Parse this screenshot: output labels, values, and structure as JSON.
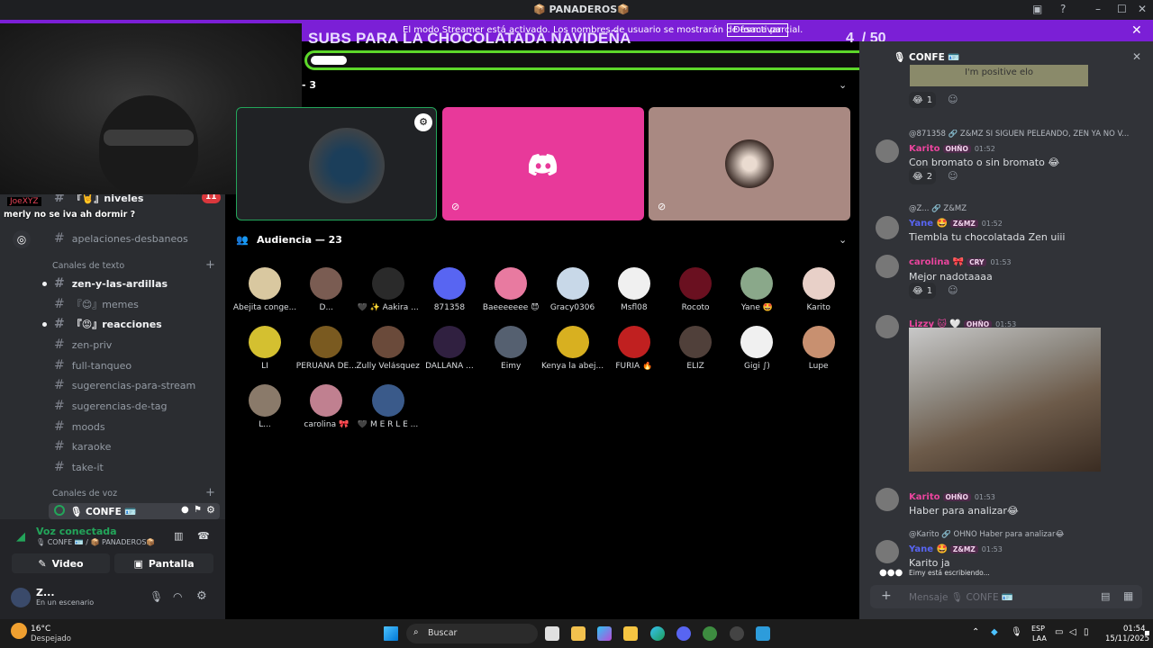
{
  "window": {
    "title": "📦 PANADEROS📦"
  },
  "streamer_banner": {
    "message": "El modo Streamer está activado. Los nombres de usuario se mostrarán de forma parcial.",
    "button": "Desactivar"
  },
  "goal": {
    "title": "SUBS PARA LA CHOCOLATADA NAVIDEÑA",
    "current": "4",
    "total": "/ 50",
    "progress": 0.08
  },
  "webcam": {
    "label_user": "JoeXYZ",
    "caption": "merly no se iva ah dormir ?"
  },
  "sidebar": {
    "channels_top": [
      {
        "label": "『🤘』niveles",
        "badge": "11"
      },
      {
        "label": "apelaciones-desbaneos"
      }
    ],
    "text_category": "Canales de texto",
    "text_channels": [
      {
        "label": "zen-y-las-ardillas",
        "bold": true
      },
      {
        "label": "『😊』memes"
      },
      {
        "label": "『😡』reacciones",
        "bold": true
      },
      {
        "label": "zen-priv"
      },
      {
        "label": "full-tanqueo"
      },
      {
        "label": "sugerencias-para-stream"
      },
      {
        "label": "sugerencias-de-tag"
      },
      {
        "label": "moods"
      },
      {
        "label": "karaoke"
      },
      {
        "label": "take-it"
      }
    ],
    "voice_category": "Canales de voz",
    "voice_channel": "🎙 CONFE 🪪",
    "voice_status": "Voz conectada",
    "voice_location": "🎙 CONFE 🪪 / 📦 PANADEROS📦",
    "video_button": "Video",
    "screen_button": "Pantalla",
    "user_name": "Z...",
    "user_status": "En un escenario"
  },
  "stage": {
    "speakers_header": "- 3",
    "audience_header": "Audiencia — 23",
    "audience": [
      "Abejita conge...",
      "D...",
      "🖤 ✨ Aakira ...",
      "871358",
      "Baeeeeeee 😈",
      "Gracy0306",
      "Msfl08",
      "Rocoto",
      "Yane 🤩",
      "Karito",
      "LI",
      "PERUANA DE...",
      "Zully Velásquez",
      "DALLANA ...",
      "Eimy",
      "Kenya la abej...",
      "FURIA 🔥",
      "ELIZ",
      "Gigi ∫)",
      "Lupe",
      "L...",
      "carolina 🎀",
      "🖤 M E R L E ..."
    ]
  },
  "chat": {
    "header": "🎙 CONFE 🪪",
    "image_text": "I'm positive elo",
    "messages": [
      {
        "reactions": "1"
      },
      {
        "reply": "@871358 🔗 Z&MZ  SI SIGUEN PELEANDO, ZEN YA NO V...",
        "name": "Karito",
        "tag": "OHÑO",
        "time": "01:52",
        "text": "Con bromato o sin bromato 😂",
        "reactions": "2",
        "name_color": "#eb459e"
      },
      {
        "reply": "@Z... 🔗 Z&MZ",
        "name": "Yane 🤩",
        "tag": "Z&MZ",
        "time": "01:52",
        "text": "Tiembla tu chocolatada Zen uiii",
        "name_color": "#5865f2"
      },
      {
        "name": "carolina 🎀",
        "tag": "CRY",
        "time": "01:53",
        "text": "Mejor nadotaaaa",
        "reactions": "1",
        "name_color": "#eb459e"
      },
      {
        "name": "Lizzy 🐱 🤍",
        "tag": "OHÑO",
        "time": "01:53",
        "name_color": "#eb459e"
      },
      {
        "name": "Karito",
        "tag": "OHÑO",
        "time": "01:53",
        "text": "Haber para analizar😂",
        "name_color": "#eb459e"
      },
      {
        "reply": "@Karito 🔗 OHÑO  Haber para analizar😂",
        "name": "Yane 🤩",
        "tag": "Z&MZ",
        "time": "01:53",
        "text": "Karito ja",
        "name_color": "#5865f2"
      }
    ],
    "typing": "Eimy está escribiendo...",
    "input_placeholder": "Mensaje 🎙 CONFE 🪪"
  },
  "taskbar": {
    "weather_temp": "16°C",
    "weather_desc": "Despejado",
    "search": "Buscar",
    "lang": "ESP",
    "lang2": "LAA",
    "time": "01:54",
    "date": "15/11/2025"
  },
  "colors": {
    "banner": "#7b1fd6",
    "goal_border": "#5dd82a",
    "discord_pink": "#e8399a"
  }
}
